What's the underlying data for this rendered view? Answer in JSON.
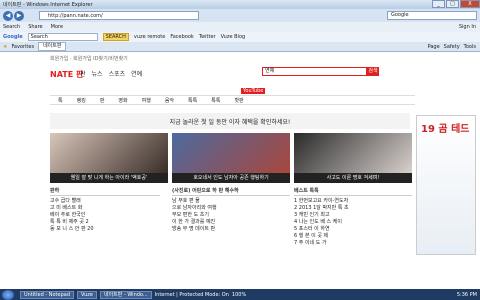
{
  "window": {
    "title": "네이트판 - Windows Internet Explorer",
    "min": "_",
    "max": "□",
    "close": "X"
  },
  "address": {
    "url": "http://pann.nate.com/",
    "search_placeholder": "Google",
    "back": "◀",
    "forward": "▶"
  },
  "menu": {
    "items": [
      "Search",
      "Share",
      "More"
    ],
    "signin": "Sign In"
  },
  "google_bar": {
    "brand": "Google",
    "input_placeholder": "Search",
    "btn": "SEARCH",
    "items": [
      "vuze remote",
      "Facebook",
      "Twitter",
      "Vuze Blog"
    ]
  },
  "favorites": {
    "label": "Favorites",
    "tab": "네이트판",
    "tools": [
      "Page",
      "Safety",
      "Tools"
    ]
  },
  "nate": {
    "logo": "NATE 판",
    "top_links": "회원가입   · 회원가입 ID찾기/비번찾기",
    "nav": [
      "판",
      "뉴스",
      "스포츠",
      "연예"
    ],
    "search_value": "연예",
    "search_btn": "검색",
    "youtube": "YouTube",
    "cats": [
      "톡",
      "랭킹",
      "판 ",
      "영화",
      "여행",
      "음악",
      "톡톡",
      "톡톡",
      "핫판"
    ],
    "banner": "지금 놀라운 첫 일 동안 이자 혜택을 확인하세요!",
    "captions": [
      "웬일 잘 맞 니게 하는 아이라 '액호공'",
      "호오네서 인도 남자아 공존 행팅하기",
      "사고도 이룬 명호 걱세며!"
    ],
    "ad_title": "19 곰 테드",
    "col1": {
      "head": "판하",
      "items": [
        "고수 곱다 빨래",
        "고 미 베스트 화",
        "베이 추로 한국인",
        "톡 톡 비 제주 곳 2",
        "동 모 니 스 안 판 20"
      ]
    },
    "col2": {
      "head": "(사진로) 어린으로 하 판 해수하",
      "items": [
        "남 부호 편 물",
        "으로 남자아리와 여행",
        "부모 편한 도 초기",
        "이 한 가 결과를 예진",
        "방송 부 명 데이트 판"
      ]
    },
    "col3": {
      "head": "베스트 톡톡",
      "items": [
        "1 한번보고요 카이-연도자",
        "2 2013 1달 박지만 톡 초",
        "3 캐빈 인기 최고",
        "4 나는 인도 베 스 케이",
        "5 포스터 이 하연",
        "6 행 본 이 곳 제",
        "7 주 이네 도 가"
      ]
    }
  },
  "taskbar": {
    "items": [
      "Untitled - Notepad",
      "Vuze",
      "네이트판 - Windo..."
    ],
    "status": "Internet | Protected Mode: On",
    "zoom": "100%",
    "clock": "5:36 PM"
  }
}
